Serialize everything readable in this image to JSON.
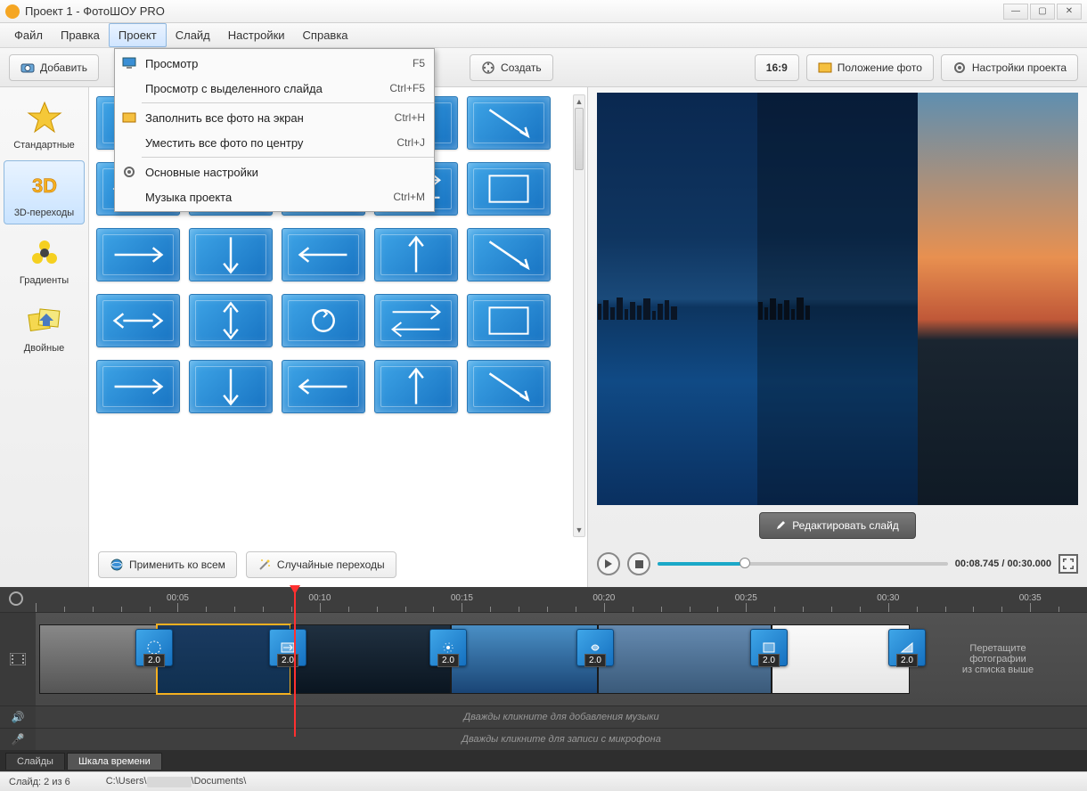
{
  "window": {
    "title": "Проект 1 - ФотоШОУ PRO"
  },
  "menubar": {
    "items": [
      "Файл",
      "Правка",
      "Проект",
      "Слайд",
      "Настройки",
      "Справка"
    ],
    "active_index": 2
  },
  "dropdown": {
    "items": [
      {
        "label": "Просмотр",
        "shortcut": "F5",
        "icon": "monitor"
      },
      {
        "label": "Просмотр с выделенного слайда",
        "shortcut": "Ctrl+F5",
        "icon": ""
      },
      {
        "sep": true
      },
      {
        "label": "Заполнить все фото на экран",
        "shortcut": "Ctrl+H",
        "icon": "fill"
      },
      {
        "label": "Уместить все фото по центру",
        "shortcut": "Ctrl+J",
        "icon": ""
      },
      {
        "sep": true
      },
      {
        "label": "Основные настройки",
        "shortcut": "",
        "icon": "gear"
      },
      {
        "label": "Музыка проекта",
        "shortcut": "Ctrl+M",
        "icon": ""
      }
    ]
  },
  "toolbar": {
    "add": "Добавить",
    "create": "Создать",
    "aspect": "16:9",
    "photo_position": "Положение фото",
    "project_settings": "Настройки проекта"
  },
  "categories": [
    {
      "label": "Стандартные",
      "icon": "star"
    },
    {
      "label": "3D-переходы",
      "icon": "3d"
    },
    {
      "label": "Градиенты",
      "icon": "gradient"
    },
    {
      "label": "Двойные",
      "icon": "double"
    }
  ],
  "categories_active_index": 1,
  "transitions_buttons": {
    "apply_all": "Применить ко всем",
    "random": "Случайные переходы"
  },
  "preview": {
    "edit_slide": "Редактировать слайд",
    "time": "00:08.745 / 00:30.000"
  },
  "ruler": {
    "labels": [
      "00:05",
      "00:10",
      "00:15",
      "00:20",
      "00:25",
      "00:30",
      "00:35"
    ]
  },
  "timeline": {
    "transition_durations": [
      "2.0",
      "2.0",
      "2.0",
      "2.0",
      "2.0",
      "2.0"
    ],
    "drop_hint_line1": "Перетащите",
    "drop_hint_line2": "фотографии",
    "drop_hint_line3": "из списка выше",
    "audio_hint": "Дважды кликните для добавления музыки",
    "mic_hint": "Дважды кликните для записи с микрофона"
  },
  "bottom_tabs": {
    "slides": "Слайды",
    "timeline": "Шкала времени",
    "active_index": 1
  },
  "status": {
    "slide_counter": "Слайд: 2 из 6",
    "path_prefix": "C:\\Users\\",
    "path_suffix": "\\Documents\\"
  }
}
